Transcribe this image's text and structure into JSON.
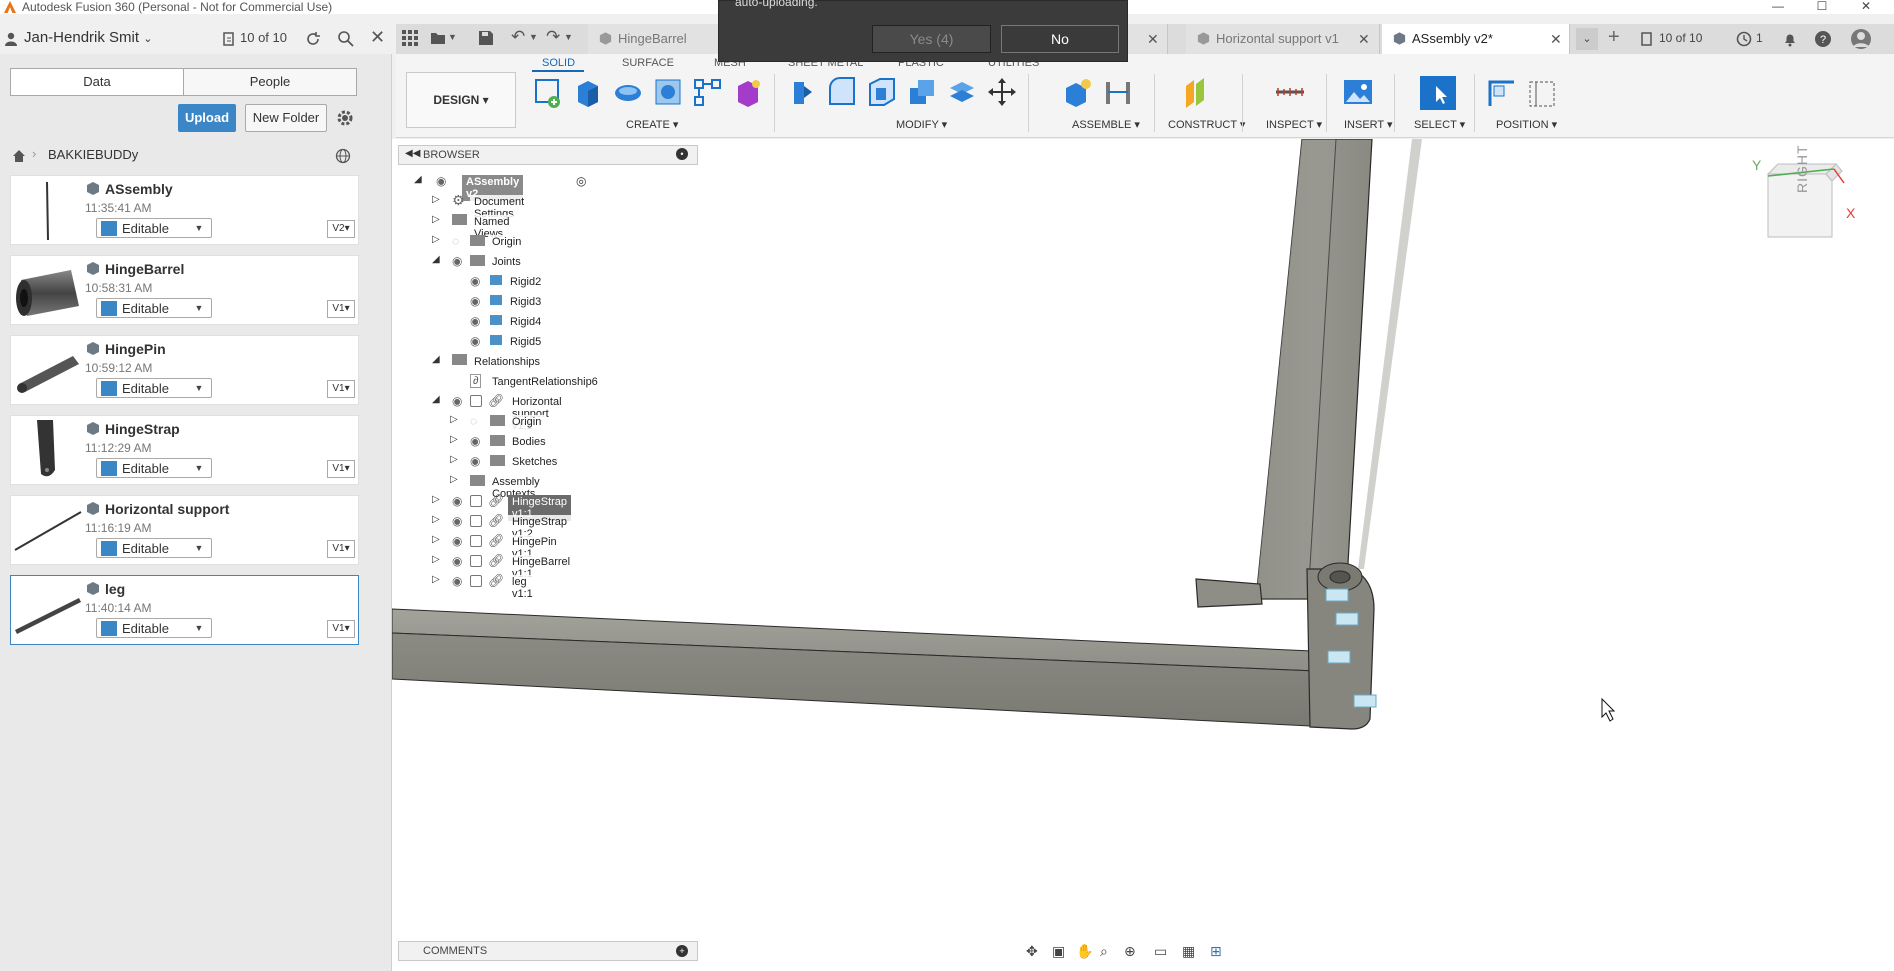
{
  "window": {
    "title": "Autodesk Fusion 360 (Personal - Not for Commercial Use)",
    "minimize": "—",
    "maximize": "☐",
    "close": "✕"
  },
  "left_header": {
    "user": "Jan-Hendrik Smit",
    "doc_count": "10 of 10"
  },
  "data_panel": {
    "tab_data": "Data",
    "tab_people": "People",
    "upload": "Upload",
    "new_folder": "New Folder",
    "project": "BAKKIEBUDDy",
    "files": [
      {
        "name": "ASsembly",
        "time": "11:35:41 AM",
        "status": "Editable",
        "version": "V2"
      },
      {
        "name": "HingeBarrel",
        "time": "10:58:31 AM",
        "status": "Editable",
        "version": "V1"
      },
      {
        "name": "HingePin",
        "time": "10:59:12 AM",
        "status": "Editable",
        "version": "V1"
      },
      {
        "name": "HingeStrap",
        "time": "11:12:29 AM",
        "status": "Editable",
        "version": "V1"
      },
      {
        "name": "Horizontal support",
        "time": "11:16:19 AM",
        "status": "Editable",
        "version": "V1"
      },
      {
        "name": "leg",
        "time": "11:40:14 AM",
        "status": "Editable",
        "version": "V1"
      }
    ]
  },
  "tabs": [
    {
      "label": "HingeBarrel"
    },
    {
      "label": "Horizontal support v1"
    },
    {
      "label": "ASsembly v2*"
    }
  ],
  "tabbar_right": {
    "count": "10 of 10",
    "jobs": "1"
  },
  "dialog": {
    "text": "auto-uploading.",
    "yes": "Yes (4)",
    "no": "No"
  },
  "ribbon": {
    "tabs": [
      "SOLID",
      "SURFACE",
      "MESH",
      "SHEET METAL",
      "PLASTIC",
      "UTILITIES"
    ],
    "design": "DESIGN ▾",
    "groups": [
      "CREATE ▾",
      "MODIFY ▾",
      "ASSEMBLE ▾",
      "CONSTRUCT ▾",
      "INSPECT ▾",
      "INSERT ▾",
      "SELECT ▾",
      "POSITION ▾"
    ]
  },
  "browser": {
    "title": "BROWSER",
    "items": [
      {
        "label": "ASsembly v2"
      },
      {
        "label": "Document Settings"
      },
      {
        "label": "Named Views"
      },
      {
        "label": "Origin"
      },
      {
        "label": "Joints"
      },
      {
        "label": "Rigid2"
      },
      {
        "label": "Rigid3"
      },
      {
        "label": "Rigid4"
      },
      {
        "label": "Rigid5"
      },
      {
        "label": "Relationships"
      },
      {
        "label": "TangentRelationship6"
      },
      {
        "label": "Horizontal support v1:1"
      },
      {
        "label": "Origin"
      },
      {
        "label": "Bodies"
      },
      {
        "label": "Sketches"
      },
      {
        "label": "Assembly Contexts"
      },
      {
        "label": "HingeStrap v1:1"
      },
      {
        "label": "HingeStrap v1:2"
      },
      {
        "label": "HingePin v1:1"
      },
      {
        "label": "HingeBarrel v1:1"
      },
      {
        "label": "leg v1:1"
      }
    ]
  },
  "viewcube": {
    "face": "RIGHT",
    "axis_y": "Y",
    "axis_x": "X"
  },
  "comments": {
    "title": "COMMENTS"
  },
  "colors": {
    "accent": "#3b86c7",
    "model": "#8a8a82",
    "ribbon_active": "#1669b5"
  }
}
